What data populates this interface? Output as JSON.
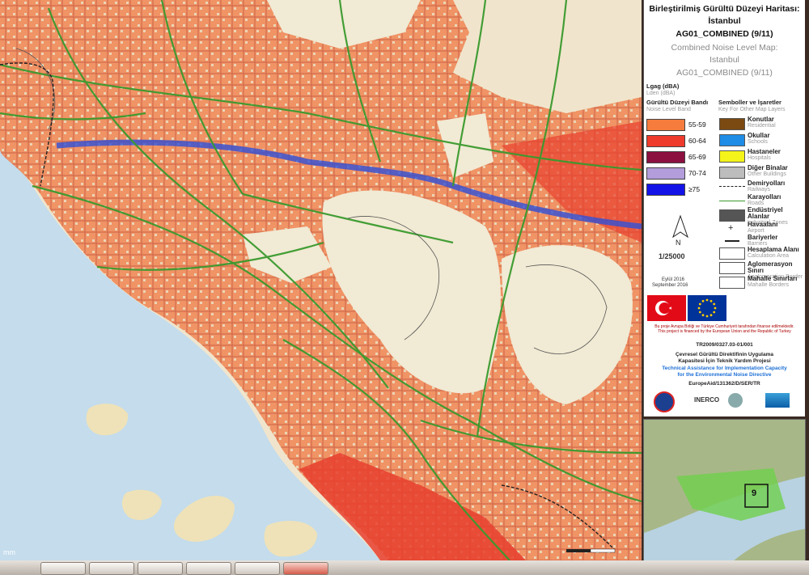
{
  "legend": {
    "title_tr_1": "Birleştirilmiş Gürültü Düzeyi Haritası:",
    "title_tr_2": "İstanbul",
    "title_tr_3": "AG01_COMBINED (9/11)",
    "title_en_1": "Combined Noise Level Map:",
    "title_en_2": "Istanbul",
    "title_en_3": "AG01_COMBINED (9/11)",
    "metric_tr": "Lgag (dBA)",
    "metric_en": "Lden (dBA)",
    "band_header_tr": "Gürültü Düzeyi Bandı",
    "band_header_en": "Noise Level Band",
    "bands": [
      {
        "label": "55-59",
        "color": "#f57c3c"
      },
      {
        "label": "60-64",
        "color": "#ef3b2c"
      },
      {
        "label": "65-69",
        "color": "#8b1040"
      },
      {
        "label": "70-74",
        "color": "#b39ddb"
      },
      {
        "label": "≥75",
        "color": "#1313e8"
      }
    ],
    "symbols_header_tr": "Semboller ve İşaretler",
    "symbols_header_en": "Key For Other Map Layers",
    "symbols": [
      {
        "tr": "Konutlar",
        "en": "Residential",
        "color": "#7a4a12"
      },
      {
        "tr": "Okullar",
        "en": "Schools",
        "color": "#1f8ce6"
      },
      {
        "tr": "Hastaneler",
        "en": "Hospitals",
        "color": "#f4f41a"
      },
      {
        "tr": "Diğer Binalar",
        "en": "Other Buildings",
        "color": "#bdbdbd"
      },
      {
        "tr": "Demiryolları",
        "en": "Railways",
        "color": "line-dash"
      },
      {
        "tr": "Karayolları",
        "en": "Roads",
        "color": "line-green"
      },
      {
        "tr": "Endüstriyel Alanlar",
        "en": "Industrial Zones",
        "color": "#555555"
      },
      {
        "tr": "Havaalanı",
        "en": "Airport",
        "color": "plus"
      },
      {
        "tr": "Bariyerler",
        "en": "Barriers",
        "color": "line-black"
      },
      {
        "tr": "Hesaplama Alanı",
        "en": "Calculation Area",
        "color": "box"
      },
      {
        "tr": "Aglomerasyon Sınırı",
        "en": "Agglomeration Border",
        "color": "box"
      },
      {
        "tr": "Mahalle Sınırları",
        "en": "Mahalle Borders",
        "color": "box"
      }
    ],
    "north_label": "N",
    "scale": "1/25000",
    "date_tr": "Eylül 2016",
    "date_en": "September 2016",
    "funding_note": "Bu proje Avrupa Birliği ve Türkiye Cumhuriyeti tarafından finanse edilmektedir.",
    "funding_note_en": "This project is financed by the European Union and the Republic of Turkey",
    "project_code": "TR2009/0327.03-01/001",
    "project_tr_1": "Çevresel Gürültü Direktifinin Uygulama",
    "project_tr_2": "Kapasitesi İçin Teknik Yardım Projesi",
    "project_en_1": "Technical Assistance for Implementation Capacity",
    "project_en_2": "for the Environmental Noise Directive",
    "contract_ref": "EuropeAid/131362/D/SER/TR",
    "logo_inerco": "INERCO"
  },
  "inset": {
    "sheet_label": "9"
  },
  "map": {
    "scale_unit": "mm"
  },
  "colors": {
    "sea": "#c4dcec",
    "land": "#efe6d0",
    "noise_low": "#f57c3c",
    "noise_mid": "#ef3b2c",
    "road": "#3a9a2e"
  }
}
